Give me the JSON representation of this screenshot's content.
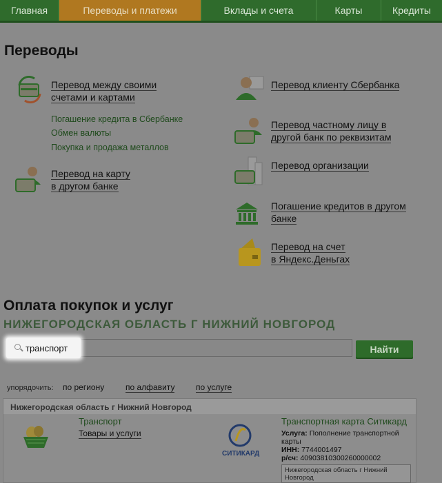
{
  "nav": {
    "tabs": [
      {
        "label": "Главная",
        "active": false
      },
      {
        "label": "Переводы и платежи",
        "active": true
      },
      {
        "label": "Вклады и счета",
        "active": false
      },
      {
        "label": "Карты",
        "active": false
      },
      {
        "label": "Кредиты",
        "active": false
      }
    ]
  },
  "transfers": {
    "title": "Переводы",
    "own_accounts_line1": "Перевод между своими",
    "own_accounts_line2": "счетами и картами",
    "sublinks": [
      "Погашение кредита в Сбербанке",
      "Обмен валюты",
      "Покупка и продажа металлов"
    ],
    "card_other_bank_line1": "Перевод на карту",
    "card_other_bank_line2": "в другом банке",
    "sberbank_client": "Перевод клиенту Сбербанка",
    "private_person_line1": "Перевод частному лицу в",
    "private_person_line2": "другой банк по реквизитам",
    "organization": "Перевод организации",
    "loan_other_bank_line1": "Погашение кредитов в другом",
    "loan_other_bank_line2": "банке",
    "yandex_line1": "Перевод на счет",
    "yandex_line2": "в Яндекс.Деньгах"
  },
  "payments": {
    "title": "Оплата покупок и услуг",
    "region": "НИЖЕГОРОДСКАЯ ОБЛАСТЬ Г НИЖНИЙ НОВГОРОД",
    "search_value": "транспорт",
    "find_label": "Найти",
    "sort_label": "упорядочить:",
    "sort_options": [
      "по региону",
      "по алфавиту",
      "по услуге"
    ]
  },
  "results": {
    "header": "Нижегородская область г Нижний Новгород",
    "left_title": "Транспорт",
    "left_sub": "Товары и услуги",
    "logo_text": "СИТИКАРД",
    "right_title": "Транспортная карта Ситикард",
    "service_label": "Услуга:",
    "service_value_line1": "Пополнение транспортной",
    "service_value_line2": "карты",
    "inn_label": "ИНН:",
    "inn_value": "7744001497",
    "account_label": "р/сч:",
    "account_value": "40903810300260000002",
    "region_line1": "Нижегородская область г Нижний",
    "region_line2": "Новгород"
  },
  "colors": {
    "accent": "#2e6b2a",
    "active_tab": "#b07820"
  }
}
